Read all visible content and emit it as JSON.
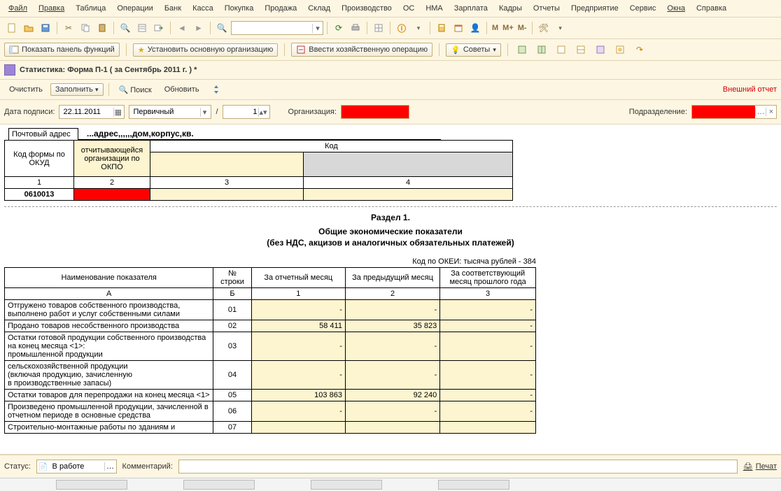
{
  "menu": [
    "Файл",
    "Правка",
    "Таблица",
    "Операции",
    "Банк",
    "Касса",
    "Покупка",
    "Продажа",
    "Склад",
    "Производство",
    "ОС",
    "НМА",
    "Зарплата",
    "Кадры",
    "Отчеты",
    "Предприятие",
    "Сервис",
    "Окна",
    "Справка"
  ],
  "menu_underline_first": [
    true,
    true,
    false,
    false,
    false,
    false,
    false,
    false,
    false,
    false,
    false,
    false,
    false,
    false,
    false,
    false,
    false,
    true,
    false
  ],
  "toolbar_m": {
    "m": "M",
    "mplus": "M+",
    "mminus": "M-"
  },
  "actions": {
    "show_panel": "Показать панель функций",
    "set_org": "Установить основную организацию",
    "enter_op": "Ввести хозяйственную операцию",
    "tips": "Советы"
  },
  "doc_title": "Статистика: Форма П-1 ( за Сентябрь 2011 г. ) *",
  "sub_actions": {
    "clear": "Очистить",
    "fill": "Заполнить",
    "search": "Поиск",
    "refresh": "Обновить"
  },
  "ext_report": "Внешний отчет",
  "params": {
    "date_label": "Дата подписи:",
    "date_value": "22.11.2011",
    "type_value": "Первичный",
    "num_value": "1",
    "org_label": "Организация:",
    "subdiv_label": "Подразделение:"
  },
  "address": {
    "label": "Почтовый адрес",
    "value": "...адрес,,,,,,дом,корпус,кв."
  },
  "hdr": {
    "okud_label": "Код формы по ОКУД",
    "okpo_label": "отчитывающейся организации по ОКПО",
    "code_label": "Код",
    "nums": [
      "1",
      "2",
      "3",
      "4"
    ],
    "okud": "0610013"
  },
  "section": {
    "title": "Раздел 1.",
    "sub": "Общие экономические показатели",
    "sub2": "(без НДС, акцизов и аналогичных обязательных платежей)"
  },
  "okei": "Код по ОКЕИ: тысяча рублей - 384",
  "cols": {
    "name": "Наименование показателя",
    "rownum": "№ строки",
    "c1": "За отчетный месяц",
    "c2": "За предыдущий месяц",
    "c3": "За соответствующий месяц прошлого года",
    "A": "А",
    "B": "Б",
    "n1": "1",
    "n2": "2",
    "n3": "3"
  },
  "rows": [
    {
      "name": "Отгружено товаров собственного производства, выполнено работ и услуг собственными силами",
      "rn": "01",
      "v1": "-",
      "v2": "-",
      "v3": "-"
    },
    {
      "name": "Продано товаров несобственного производства",
      "rn": "02",
      "v1": "58 411",
      "v2": "35 823",
      "v3": "-"
    },
    {
      "name": "Остатки готовой продукции собственного производства на конец месяца <1>:\n    промышленной продукции",
      "rn": "03",
      "v1": "-",
      "v2": "-",
      "v3": "-"
    },
    {
      "name": "    сельскохозяйственной продукции\n    (включая продукцию, зачисленную\n    в производственные запасы)",
      "rn": "04",
      "v1": "-",
      "v2": "-",
      "v3": "-"
    },
    {
      "name": "Остатки товаров для перепродажи на конец месяца <1>",
      "rn": "05",
      "v1": "103 863",
      "v2": "92 240",
      "v3": "-"
    },
    {
      "name": "Произведено промышленной продукции, зачисленной в отчетном периоде в основные средства",
      "rn": "06",
      "v1": "-",
      "v2": "-",
      "v3": "-"
    },
    {
      "name": "Строительно-монтажные работы по зданиям и",
      "rn": "07",
      "v1": "",
      "v2": "",
      "v3": ""
    }
  ],
  "footer": {
    "status_label": "Статус:",
    "status_value": "В работе",
    "comment_label": "Комментарий:",
    "print": "Печат"
  }
}
